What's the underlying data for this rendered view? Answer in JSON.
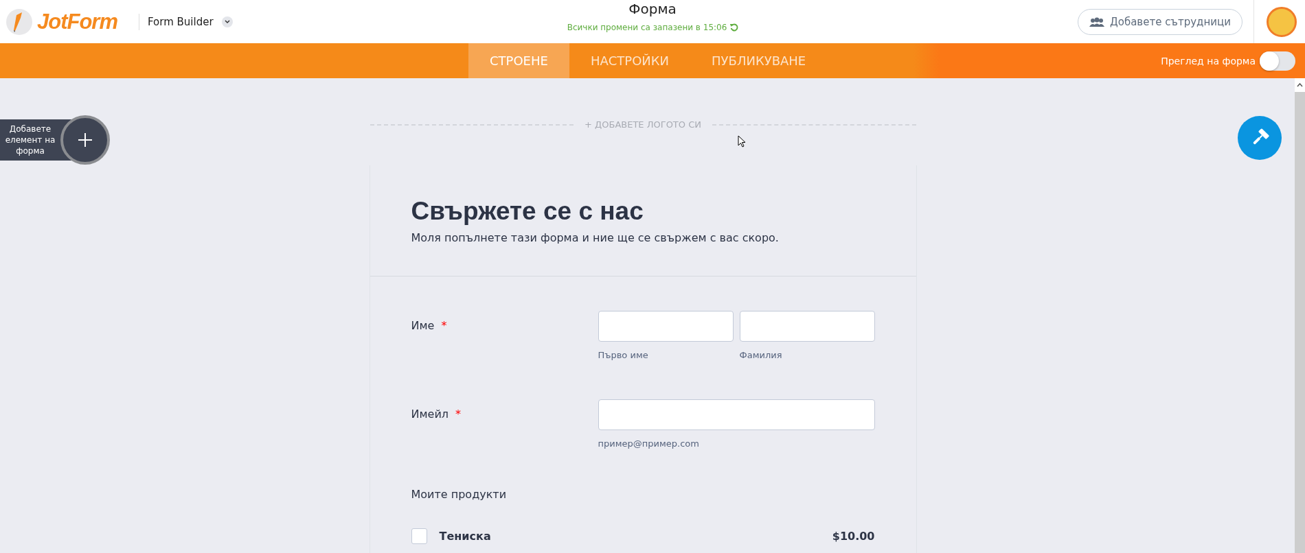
{
  "header": {
    "logo": "JotForm",
    "app_menu": "Form Builder",
    "title": "Форма",
    "save_status": "Всички промени са запазени в 15:06",
    "collaborators_button": "Добавете сътрудници"
  },
  "tabs": [
    {
      "label": "СТРОЕНЕ",
      "selected": true
    },
    {
      "label": "НАСТРОЙКИ",
      "selected": false
    },
    {
      "label": "ПУБЛИКУВАНЕ",
      "selected": false
    }
  ],
  "preview": {
    "label": "Преглед на форма",
    "on": false
  },
  "add_element": {
    "label": "Добавете елемент на форма"
  },
  "logo_placeholder": "+ ДОБАВЕТЕ ЛОГОТО СИ",
  "form": {
    "title": "Свържете се с нас",
    "subtitle": "Моля попълнете тази форма и ние ще се свържем с вас скоро.",
    "fields": [
      {
        "kind": "name",
        "label": "Име",
        "required_mark": "*",
        "sublabels": [
          "Първо име",
          "Фамилия"
        ]
      },
      {
        "kind": "email",
        "label": "Имейл",
        "required_mark": "*",
        "sublabels": [
          "пример@пример.com"
        ]
      },
      {
        "kind": "products",
        "label": "Моите продукти",
        "products": [
          {
            "name": "Тениска",
            "price": "$10.00",
            "checked": false
          }
        ]
      }
    ]
  }
}
